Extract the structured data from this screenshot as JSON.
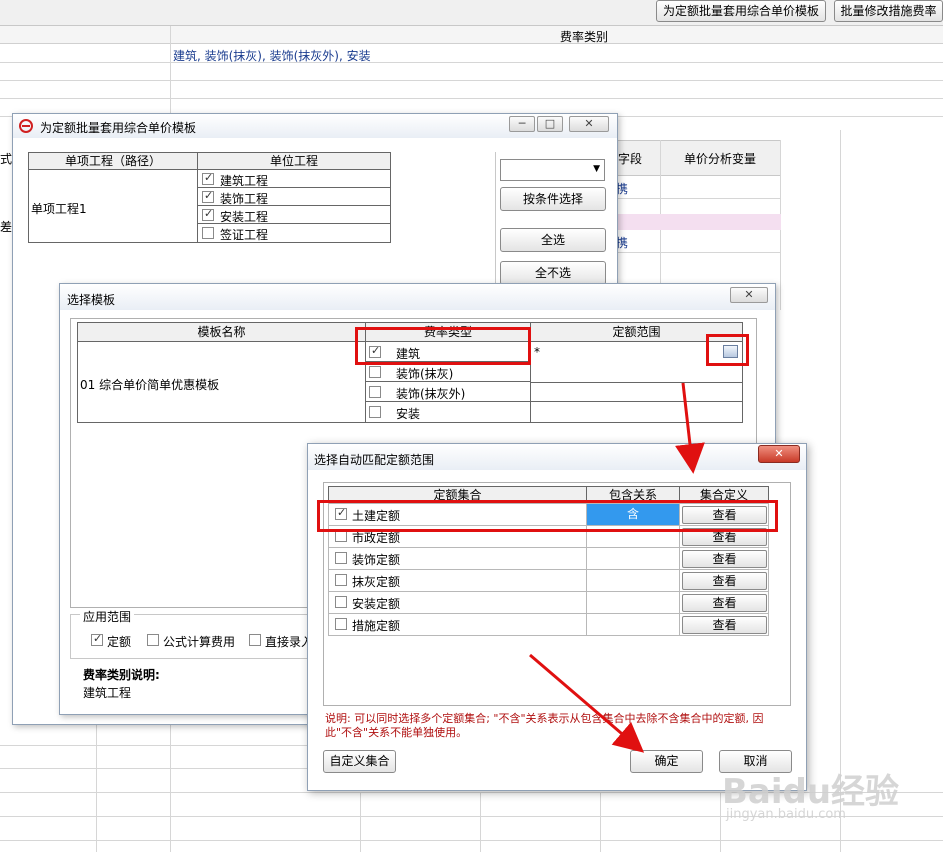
{
  "background": {
    "toolbar_btn1": "为定额批量套用综合单价模板",
    "toolbar_btn2": "批量修改措施费率",
    "col_header_fee": "费率类别",
    "fee_row": "建筑, 装饰(抹灰), 装饰(抹灰外), 安装",
    "right_col1": "字段",
    "right_col2": "单价分析变量",
    "cut_left1": "式",
    "cut_left2": "差",
    "frag1": "携",
    "frag2": "携"
  },
  "dialog1": {
    "title": "为定额批量套用综合单价模板",
    "col1": "单项工程（路径）",
    "col2": "单位工程",
    "project": "单项工程1",
    "units": [
      {
        "label": "建筑工程",
        "checked": true
      },
      {
        "label": "装饰工程",
        "checked": true
      },
      {
        "label": "安装工程",
        "checked": true
      },
      {
        "label": "签证工程",
        "checked": false
      }
    ],
    "btn_condition": "按条件选择",
    "btn_all": "全选",
    "btn_none": "全不选"
  },
  "dialog2": {
    "title": "选择模板",
    "col_name": "模板名称",
    "col_type": "费率类型",
    "col_range": "定额范围",
    "template": "01  综合单价简单优惠模板",
    "types": [
      {
        "label": "建筑",
        "checked": true
      },
      {
        "label": "装饰(抹灰)",
        "checked": false
      },
      {
        "label": "装饰(抹灰外)",
        "checked": false
      },
      {
        "label": "安装",
        "checked": false
      }
    ],
    "range_value": "*",
    "scope_title": "应用范围",
    "scope_items": [
      {
        "label": "定额",
        "checked": true
      },
      {
        "label": "公式计算费用",
        "checked": false
      },
      {
        "label": "直接录入",
        "checked": false
      }
    ],
    "desc_title": "费率类别说明:",
    "desc_value": "建筑工程"
  },
  "dialog3": {
    "title": "选择自动匹配定额范围",
    "col_set": "定额集合",
    "col_rel": "包含关系",
    "col_def": "集合定义",
    "rows": [
      {
        "label": "土建定额",
        "checked": true,
        "rel": "含",
        "view": "查看"
      },
      {
        "label": "市政定额",
        "checked": false,
        "rel": "",
        "view": "查看"
      },
      {
        "label": "装饰定额",
        "checked": false,
        "rel": "",
        "view": "查看"
      },
      {
        "label": "抹灰定额",
        "checked": false,
        "rel": "",
        "view": "查看"
      },
      {
        "label": "安装定额",
        "checked": false,
        "rel": "",
        "view": "查看"
      },
      {
        "label": "措施定额",
        "checked": false,
        "rel": "",
        "view": "查看"
      }
    ],
    "note": "说明: 可以同时选择多个定额集合; \"不含\"关系表示从包含集合中去除不含集合中的定额, 因此\"不含\"关系不能单独使用。",
    "btn_custom": "自定义集合",
    "btn_ok": "确定",
    "btn_cancel": "取消"
  },
  "watermark": {
    "brand": "Baidu经验",
    "url": "jingyan.baidu.com"
  },
  "colors": {
    "highlight_red": "#e01010",
    "contains_cell": "#3399ee",
    "note_text": "#b01010",
    "title_text": "#1a1a1a"
  }
}
